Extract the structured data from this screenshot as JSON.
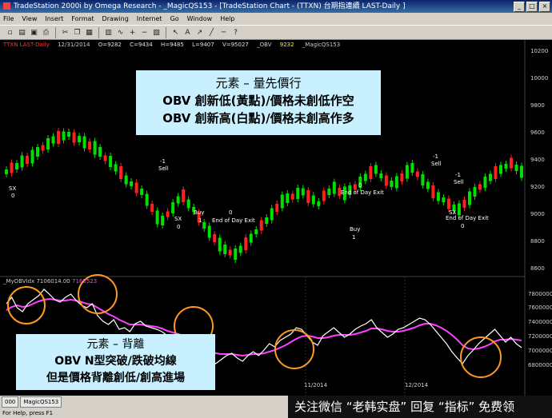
{
  "window": {
    "title": "TradeStation 2000i by Omega Research - _MagicQS153 - [TradeStation Chart - (TTXN) 台期指連續 LAST-Daily ]",
    "controls": [
      "_",
      "□",
      "×"
    ]
  },
  "menu": [
    "File",
    "View",
    "Insert",
    "Format",
    "Drawing",
    "Internet",
    "Go",
    "Window",
    "Help"
  ],
  "toolbar": {
    "icons": [
      "new-icon",
      "open-icon",
      "save-icon",
      "print-icon",
      "cut-icon",
      "copy-icon",
      "paste-icon",
      "chart-icon",
      "indicator-icon",
      "zoom-in-icon",
      "zoom-out-icon",
      "data-icon",
      "cursor-icon",
      "text-icon",
      "arrow-icon",
      "trendline-icon",
      "hline-icon",
      "help-icon"
    ]
  },
  "chart": {
    "header": {
      "symbol": "TTXN LAST-Daily",
      "date": "12/31/2014",
      "open": "O=9282",
      "close": "C=9434",
      "high": "H=9485",
      "low": "L=9407",
      "volume": "V=95027",
      "obv_label": "_OBV",
      "obv_value": "9232",
      "strategy": "_MagicQS153"
    },
    "indicator_header": {
      "name": "_MyOBVIdx",
      "value1": "7106014.00",
      "value2": "7165523"
    },
    "price_axis": [
      "10200",
      "10000",
      "9800",
      "9600",
      "9400",
      "9200",
      "9000",
      "8800",
      "8600"
    ],
    "obv_axis": [
      "7800000",
      "7600000",
      "7400000",
      "7200000",
      "7000000",
      "6800000"
    ],
    "x_labels": [
      "11/2014",
      "12/2014"
    ],
    "signals": [
      {
        "text": "SX"
      },
      {
        "text": "0"
      },
      {
        "text": "-1"
      },
      {
        "text": "Sell"
      },
      {
        "text": "SX"
      },
      {
        "text": "0"
      },
      {
        "text": "Buy"
      },
      {
        "text": "1"
      },
      {
        "text": "0"
      },
      {
        "text": "End of Day Exit"
      },
      {
        "text": "0"
      },
      {
        "text": "End of Day Exit"
      },
      {
        "text": "Buy"
      },
      {
        "text": "1"
      },
      {
        "text": "-1"
      },
      {
        "text": "Sell"
      },
      {
        "text": "-1"
      },
      {
        "text": "Sell"
      },
      {
        "text": "SX"
      },
      {
        "text": "End of Day Exit"
      },
      {
        "text": "0"
      }
    ]
  },
  "annotations": {
    "top": {
      "line1": "元素 – 量先價行",
      "line2": "OBV 創新低(黃點)/價格未創低作空",
      "line3": "OBV 創新高(白點)/價格未創高作多"
    },
    "bottom": {
      "line1": "元素 – 背離",
      "line2": "OBV N型突破/跌破均線",
      "line3": "但是價格背離創低/創高進場"
    }
  },
  "tabs": [
    "000",
    "MagicQS153"
  ],
  "status": "For Help, press F1",
  "watermark": "关注微信 “老韩实盘” 回复 “指标” 免费领",
  "colors": {
    "bull": "#00e000",
    "bear": "#ff2020",
    "obv": "#ffffff",
    "obv_ma": "#ff40ff",
    "circle": "#ff9a20",
    "note_bg": "#c8f0ff"
  }
}
